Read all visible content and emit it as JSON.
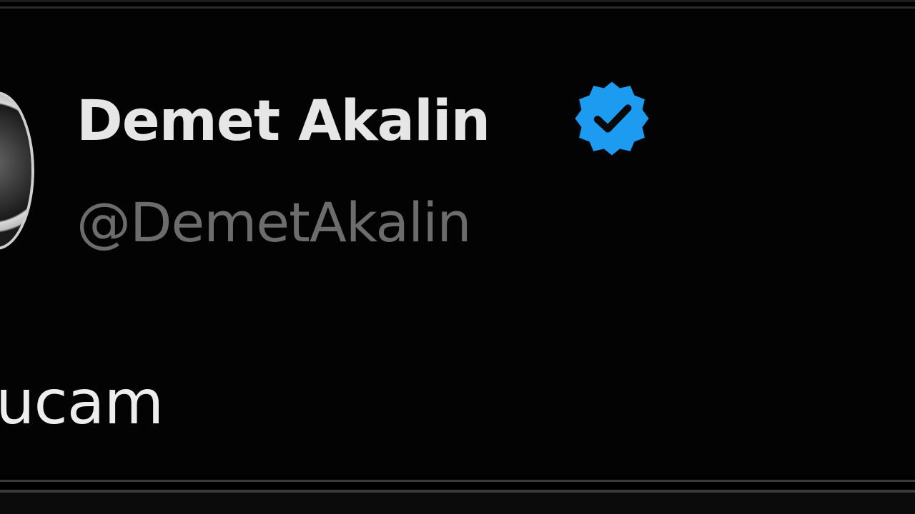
{
  "tweet": {
    "author": {
      "display_name": "Demet Akalin",
      "handle": "@DemetAkalin",
      "verified_icon": "verified-badge-icon",
      "badge_color": "#1d9bf0"
    },
    "text": "ucam"
  },
  "colors": {
    "background": "#030303",
    "name": "#e6e6e6",
    "handle": "#6c6c6c",
    "text": "#ededed"
  }
}
